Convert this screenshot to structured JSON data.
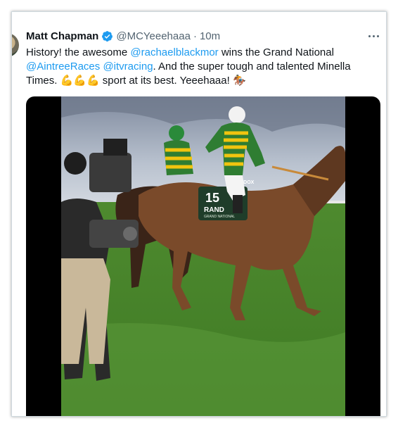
{
  "tweet": {
    "author_name": "Matt Chapman",
    "author_handle": "@MCYeeehaaa",
    "separator": "·",
    "timestamp": "10m",
    "text_parts": [
      {
        "type": "text",
        "value": "History! the awesome "
      },
      {
        "type": "mention",
        "value": "@rachaelblackmor"
      },
      {
        "type": "text",
        "value": " wins the Grand National "
      },
      {
        "type": "mention",
        "value": "@AintreeRaces"
      },
      {
        "type": "text",
        "value": " "
      },
      {
        "type": "mention",
        "value": "@itvracing"
      },
      {
        "type": "text",
        "value": ". And the super tough and talented Minella Times. 💪💪💪 sport at its best. Yeeehaaa! 🏇"
      }
    ]
  },
  "media": {
    "saddle_cloth_number": "15",
    "saddle_cloth_text": "RAND",
    "saddle_cloth_sub": "GRAND NATIONAL",
    "bridle_text": "RANDOX"
  },
  "colors": {
    "link": "#1d9bf0",
    "verified_badge": "#1d9bf0",
    "muted_text": "#536471",
    "primary_text": "#0f1419"
  },
  "icons": {
    "verified": "verified-badge-icon",
    "more": "more-horizontal-icon"
  }
}
